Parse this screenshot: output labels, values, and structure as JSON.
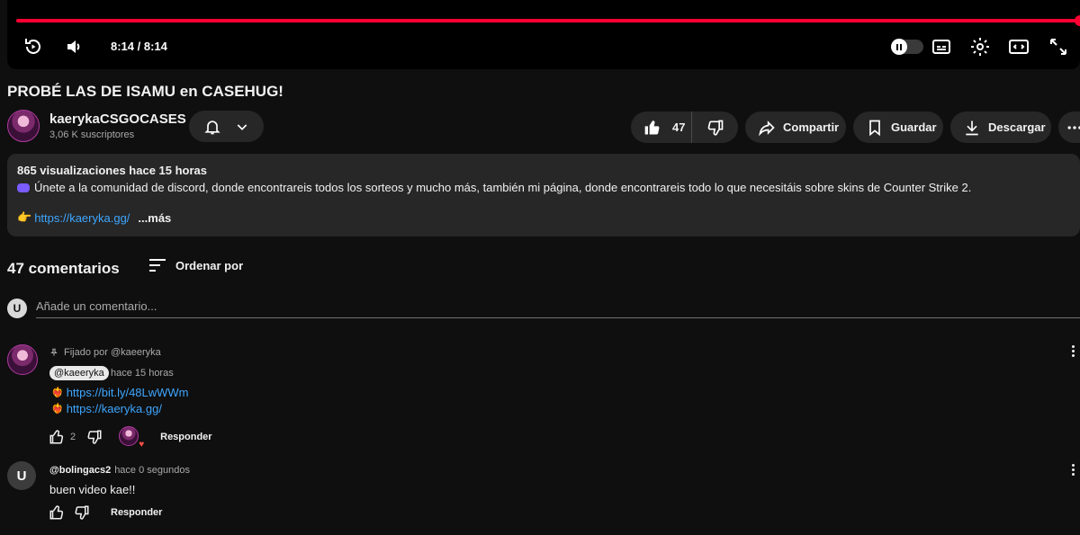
{
  "player": {
    "time": "8:14 / 8:14",
    "progress": 1.0,
    "accent_color": "#ff0033",
    "controls": [
      "replay-icon",
      "volume-icon",
      "autoplay-toggle",
      "subtitles-icon",
      "settings-gear-icon",
      "miniplayer-icon",
      "fullscreen-icon"
    ]
  },
  "video": {
    "title": "PROBÉ LAS DE ISAMU en CASEHUG!"
  },
  "channel": {
    "name": "kaerykaCSGOCASES",
    "subscribers": "3,06 K suscriptores"
  },
  "actions": {
    "likes": "47",
    "share": "Compartir",
    "save": "Guardar",
    "download": "Descargar"
  },
  "description": {
    "stats": "865 visualizaciones  hace 15 horas",
    "text": "Únete a la comunidad de discord, donde encontrareis todos los sorteos y mucho más, también mi página, donde encontrareis todo lo que necesitáis sobre skins de Counter Strike 2.",
    "link": "https://kaeryka.gg/",
    "more": "...más"
  },
  "comments": {
    "count": "47 comentarios",
    "sort_label": "Ordenar por",
    "user_initial": "U",
    "add_placeholder": "Añade un comentario...",
    "items": [
      {
        "pinned": "Fijado por @kaeeryka",
        "author": "@kaeeryka",
        "time": "hace 15 horas",
        "links": [
          "https://bit.ly/48LwWWm",
          "https://kaeryka.gg/"
        ],
        "likes": "2",
        "reply": "Responder"
      },
      {
        "avatar_initial": "U",
        "author": "@bolingacs2",
        "time": "hace 0 segundos",
        "text": "buen video kae!!",
        "reply": "Responder"
      }
    ]
  }
}
